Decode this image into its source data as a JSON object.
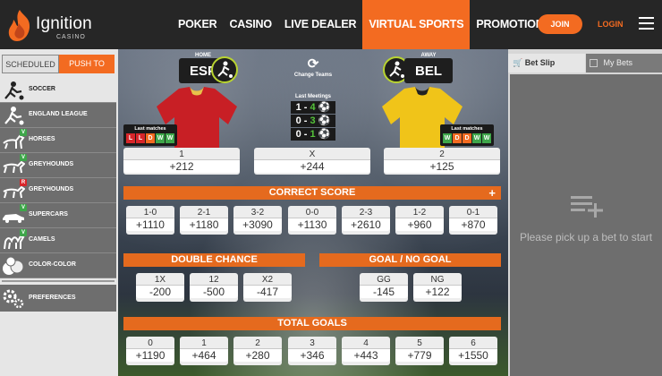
{
  "brand": {
    "name": "Ignition",
    "sub": "CASINO"
  },
  "nav": [
    "POKER",
    "CASINO",
    "LIVE DEALER",
    "VIRTUAL SPORTS",
    "PROMOTIONS"
  ],
  "join": "JOIN",
  "login": "LOGIN",
  "sidebar": {
    "tab_scheduled": "SCHEDULED",
    "tab_push": "PUSH TO PLAY",
    "items": [
      "SOCCER",
      "ENGLAND LEAGUE",
      "HORSES",
      "GREYHOUNDS",
      "GREYHOUNDS",
      "SUPERCARS",
      "CAMELS",
      "COLOR-COLOR"
    ],
    "badge_v": "V",
    "badge_r": "R",
    "preferences": "PREFERENCES"
  },
  "match": {
    "home_label": "HOME",
    "home": "ESP",
    "away_label": "AWAY",
    "away": "BEL",
    "change_teams": "Change Teams",
    "last_meetings_title": "Last Meetings",
    "meetings": [
      [
        "1 - ",
        "4"
      ],
      [
        "0 - ",
        "3"
      ],
      [
        "0 - ",
        "1"
      ]
    ],
    "last_matches_title": "Last matches",
    "home_last": [
      "L",
      "L",
      "D",
      "W",
      "W"
    ],
    "away_last": [
      "W",
      "D",
      "D",
      "W",
      "W"
    ],
    "result_odds": [
      {
        "label": "1",
        "odds": "+212"
      },
      {
        "label": "X",
        "odds": "+244"
      },
      {
        "label": "2",
        "odds": "+125"
      }
    ]
  },
  "correct_score": {
    "title": "CORRECT SCORE",
    "plus": "+",
    "items": [
      {
        "label": "1-0",
        "odds": "+1110"
      },
      {
        "label": "2-1",
        "odds": "+1180"
      },
      {
        "label": "3-2",
        "odds": "+3090"
      },
      {
        "label": "0-0",
        "odds": "+1130"
      },
      {
        "label": "2-3",
        "odds": "+2610"
      },
      {
        "label": "1-2",
        "odds": "+960"
      },
      {
        "label": "0-1",
        "odds": "+870"
      }
    ]
  },
  "double_chance": {
    "title": "DOUBLE CHANCE",
    "items": [
      {
        "label": "1X",
        "odds": "-200"
      },
      {
        "label": "12",
        "odds": "-500"
      },
      {
        "label": "X2",
        "odds": "-417"
      }
    ]
  },
  "goal_no_goal": {
    "title": "GOAL / NO GOAL",
    "items": [
      {
        "label": "GG",
        "odds": "-145"
      },
      {
        "label": "NG",
        "odds": "+122"
      }
    ]
  },
  "total_goals": {
    "title": "TOTAL GOALS",
    "items": [
      {
        "label": "0",
        "odds": "+1190"
      },
      {
        "label": "1",
        "odds": "+464"
      },
      {
        "label": "2",
        "odds": "+280"
      },
      {
        "label": "3",
        "odds": "+346"
      },
      {
        "label": "4",
        "odds": "+443"
      },
      {
        "label": "5",
        "odds": "+779"
      },
      {
        "label": "6",
        "odds": "+1550"
      }
    ]
  },
  "betslip": {
    "tab": "Bet Slip",
    "mybets": "My Bets",
    "empty": "Please pick up a bet to start"
  },
  "colors": {
    "accent": "#f36b21",
    "win": "#3ea64a",
    "loss": "#d8262a",
    "draw": "#f36b21"
  }
}
